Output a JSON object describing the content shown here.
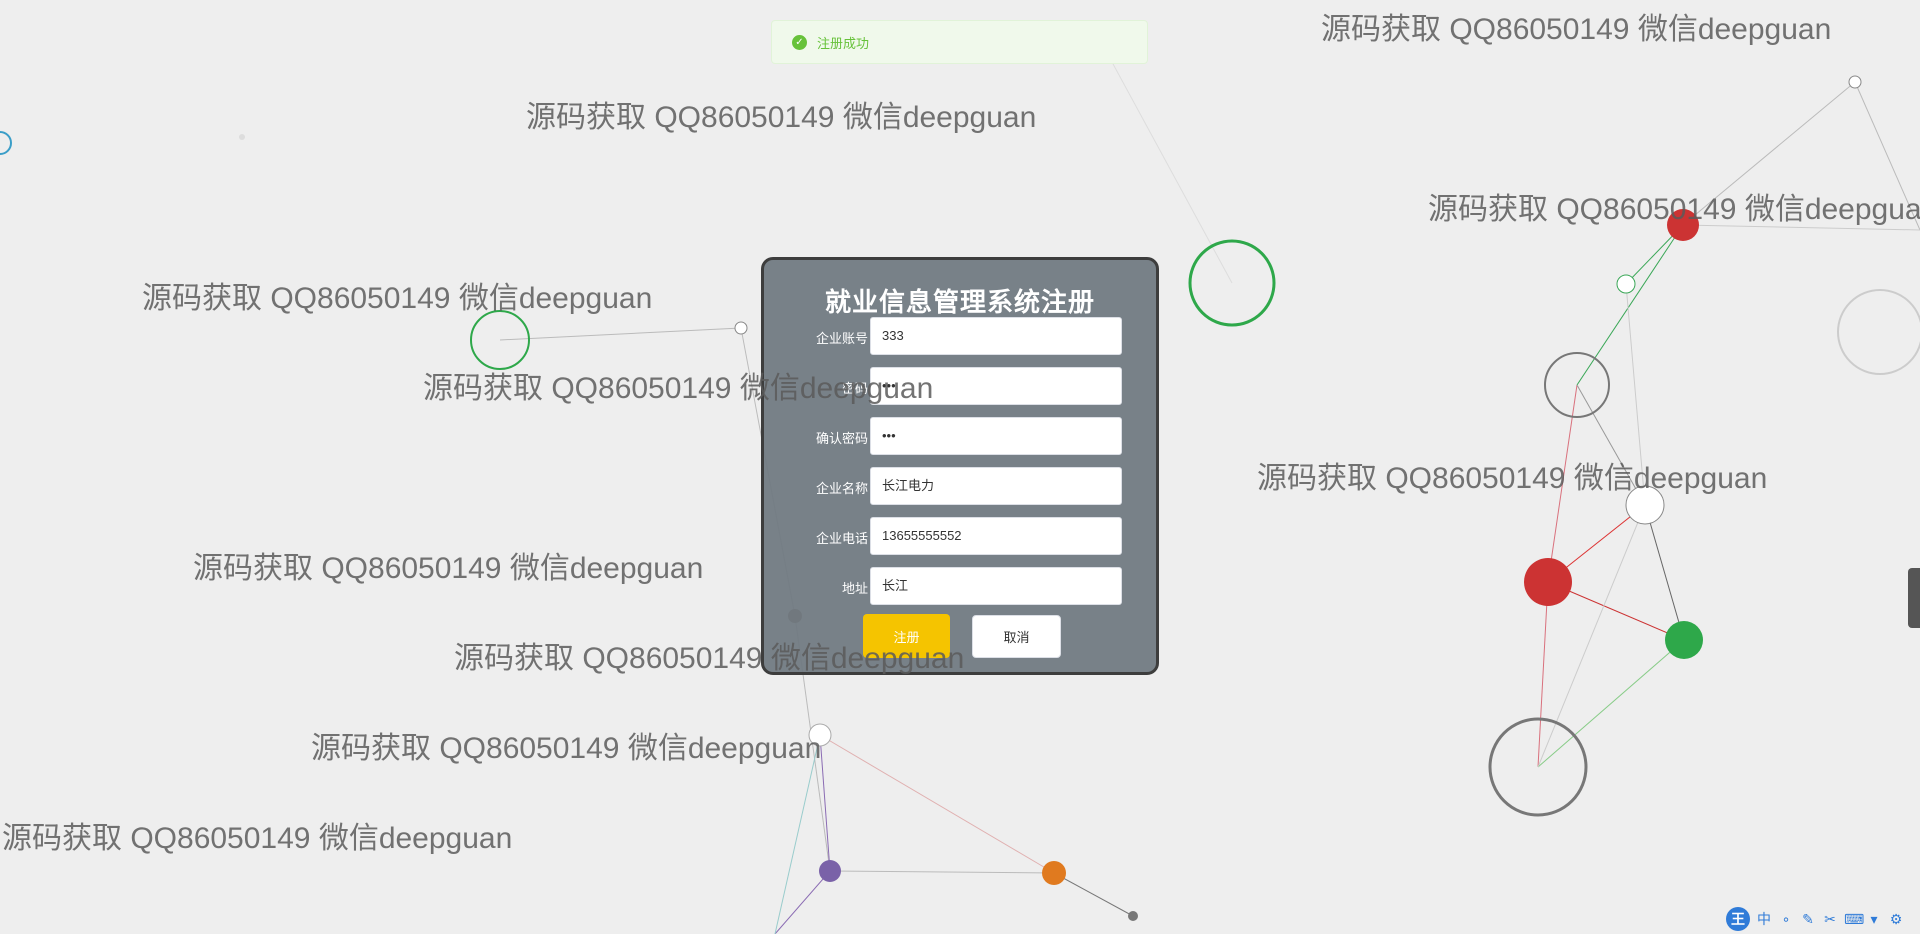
{
  "toast": {
    "message": "注册成功",
    "icon": "check-circle-icon",
    "color": "#67c23a"
  },
  "form": {
    "title": "就业信息管理系统注册",
    "fields": [
      {
        "label": "企业账号",
        "value": "333",
        "type": "text"
      },
      {
        "label": "密码",
        "value": "•••",
        "type": "password"
      },
      {
        "label": "确认密码",
        "value": "•••",
        "type": "password"
      },
      {
        "label": "企业名称",
        "value": "长江电力",
        "type": "text"
      },
      {
        "label": "企业电话",
        "value": "13655555552",
        "type": "text"
      },
      {
        "label": "地址",
        "value": "长江",
        "type": "text"
      }
    ],
    "register_label": "注册",
    "cancel_label": "取消",
    "accent_color": "#f5c400"
  },
  "watermark": "源码获取 QQ86050149 微信deepguan",
  "ime_toolbar": {
    "logo": "王",
    "lang": "中",
    "items": [
      "dot-icon",
      "pen-icon",
      "scissors-icon",
      "keyboard-icon",
      "shirt-icon",
      "gear-icon"
    ]
  }
}
